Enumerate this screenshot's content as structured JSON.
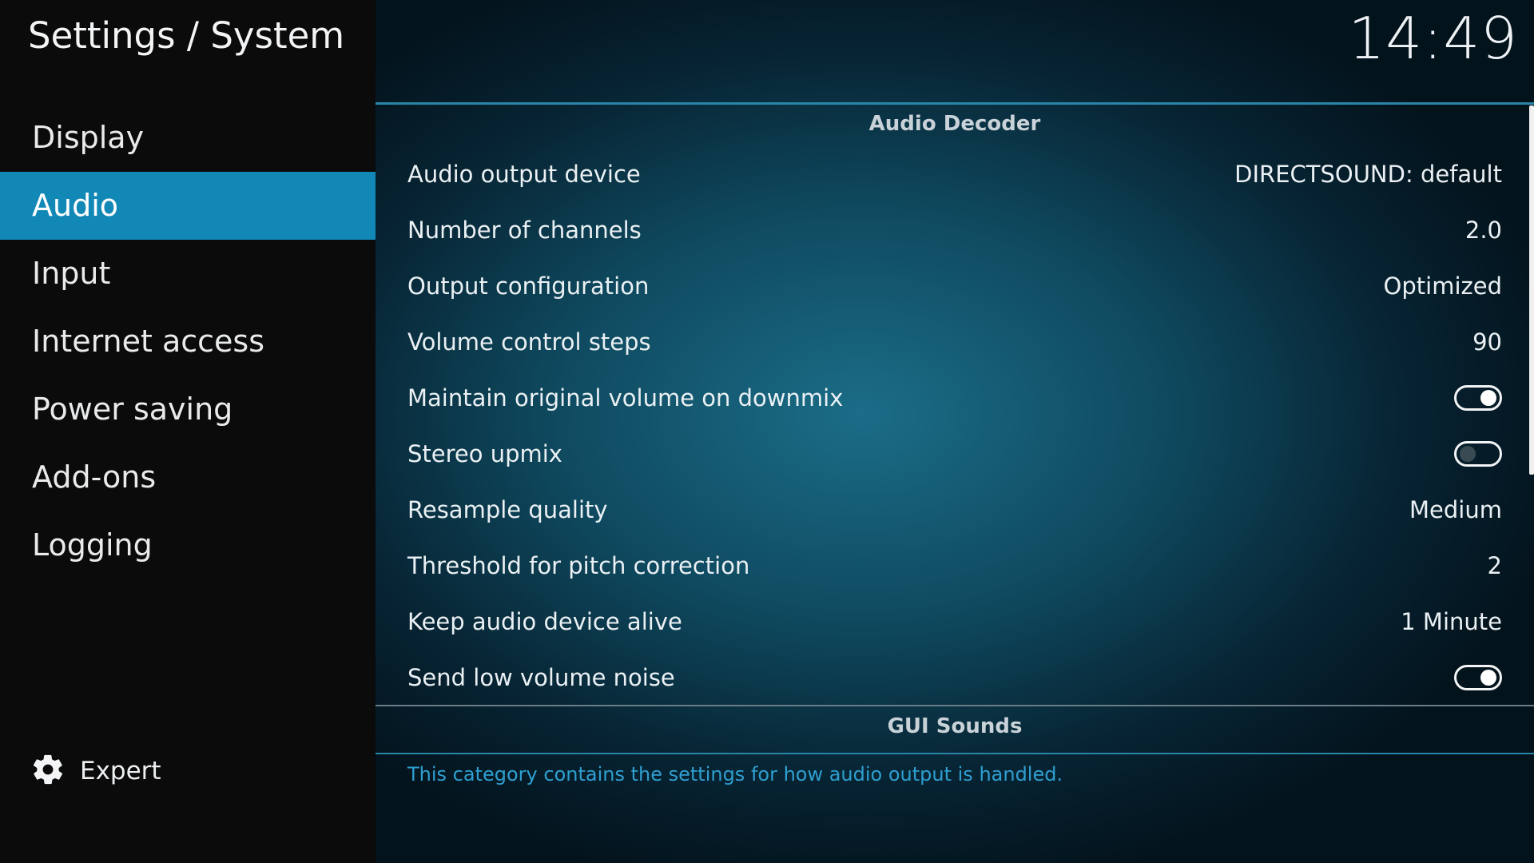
{
  "header": {
    "title": "Settings / System",
    "clock": "14:49"
  },
  "sidebar": {
    "items": [
      {
        "label": "Display",
        "active": false
      },
      {
        "label": "Audio",
        "active": true
      },
      {
        "label": "Input",
        "active": false
      },
      {
        "label": "Internet access",
        "active": false
      },
      {
        "label": "Power saving",
        "active": false
      },
      {
        "label": "Add-ons",
        "active": false
      },
      {
        "label": "Logging",
        "active": false
      }
    ],
    "expert": {
      "label": "Expert",
      "icon": "gear-icon"
    }
  },
  "main": {
    "section_title": "Audio Decoder",
    "rows": [
      {
        "label": "Audio output device",
        "value": "DIRECTSOUND: default"
      },
      {
        "label": "Number of channels",
        "value": "2.0"
      },
      {
        "label": "Output configuration",
        "value": "Optimized"
      },
      {
        "label": "Volume control steps",
        "value": "90"
      },
      {
        "label": "Maintain original volume on downmix",
        "toggle": true
      },
      {
        "label": "Stereo upmix",
        "toggle": false
      },
      {
        "label": "Resample quality",
        "value": "Medium"
      },
      {
        "label": "Threshold for pitch correction",
        "value": "2"
      },
      {
        "label": "Keep audio device alive",
        "value": "1 Minute"
      },
      {
        "label": "Send low volume noise",
        "toggle": true
      }
    ],
    "next_section_title": "GUI Sounds",
    "description": "This category contains the settings for how audio output is handled."
  },
  "colors": {
    "accent": "#1288b7",
    "description_text": "#2f9fd0",
    "sidebar_bg": "#0b0b0b"
  }
}
